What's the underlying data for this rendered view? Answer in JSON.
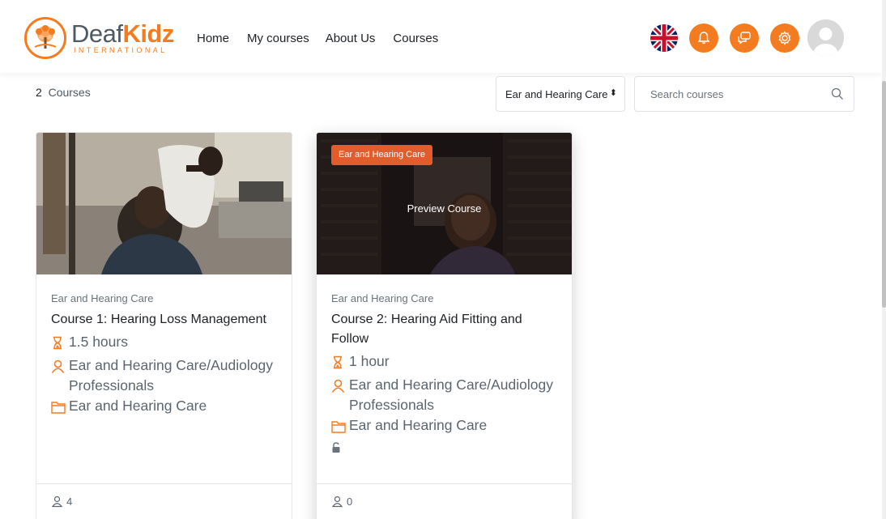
{
  "brand": {
    "name_part1": "Deaf",
    "name_part2": "Kidz",
    "tagline": "INTERNATIONAL",
    "accent": "#f47c20"
  },
  "nav": {
    "links": [
      "Home",
      "My courses",
      "About Us",
      "Courses"
    ]
  },
  "header_icons": [
    "uk-flag-icon",
    "bell-icon",
    "chat-icon",
    "gear-icon",
    "user-avatar"
  ],
  "toolbar": {
    "count": "2",
    "count_suffix": "Courses",
    "category_select": "Ear and Hearing Care",
    "search_placeholder": "Search courses"
  },
  "courses": [
    {
      "category": "Ear and Hearing Care",
      "title": "Course 1: Hearing Loss Management",
      "duration": "1.5 hours",
      "audience": "Ear and Hearing Care/Audiology Professionals",
      "folder": "Ear and Hearing Care",
      "participants": "4"
    },
    {
      "badge": "Ear and Hearing Care",
      "overlay": "Preview Course",
      "category": "Ear and Hearing Care",
      "title": "Course 2: Hearing Aid Fitting and Follow",
      "duration": "1 hour",
      "audience": "Ear and Hearing Care/Audiology Professionals",
      "folder": "Ear and Hearing Care",
      "participants": "0"
    }
  ]
}
